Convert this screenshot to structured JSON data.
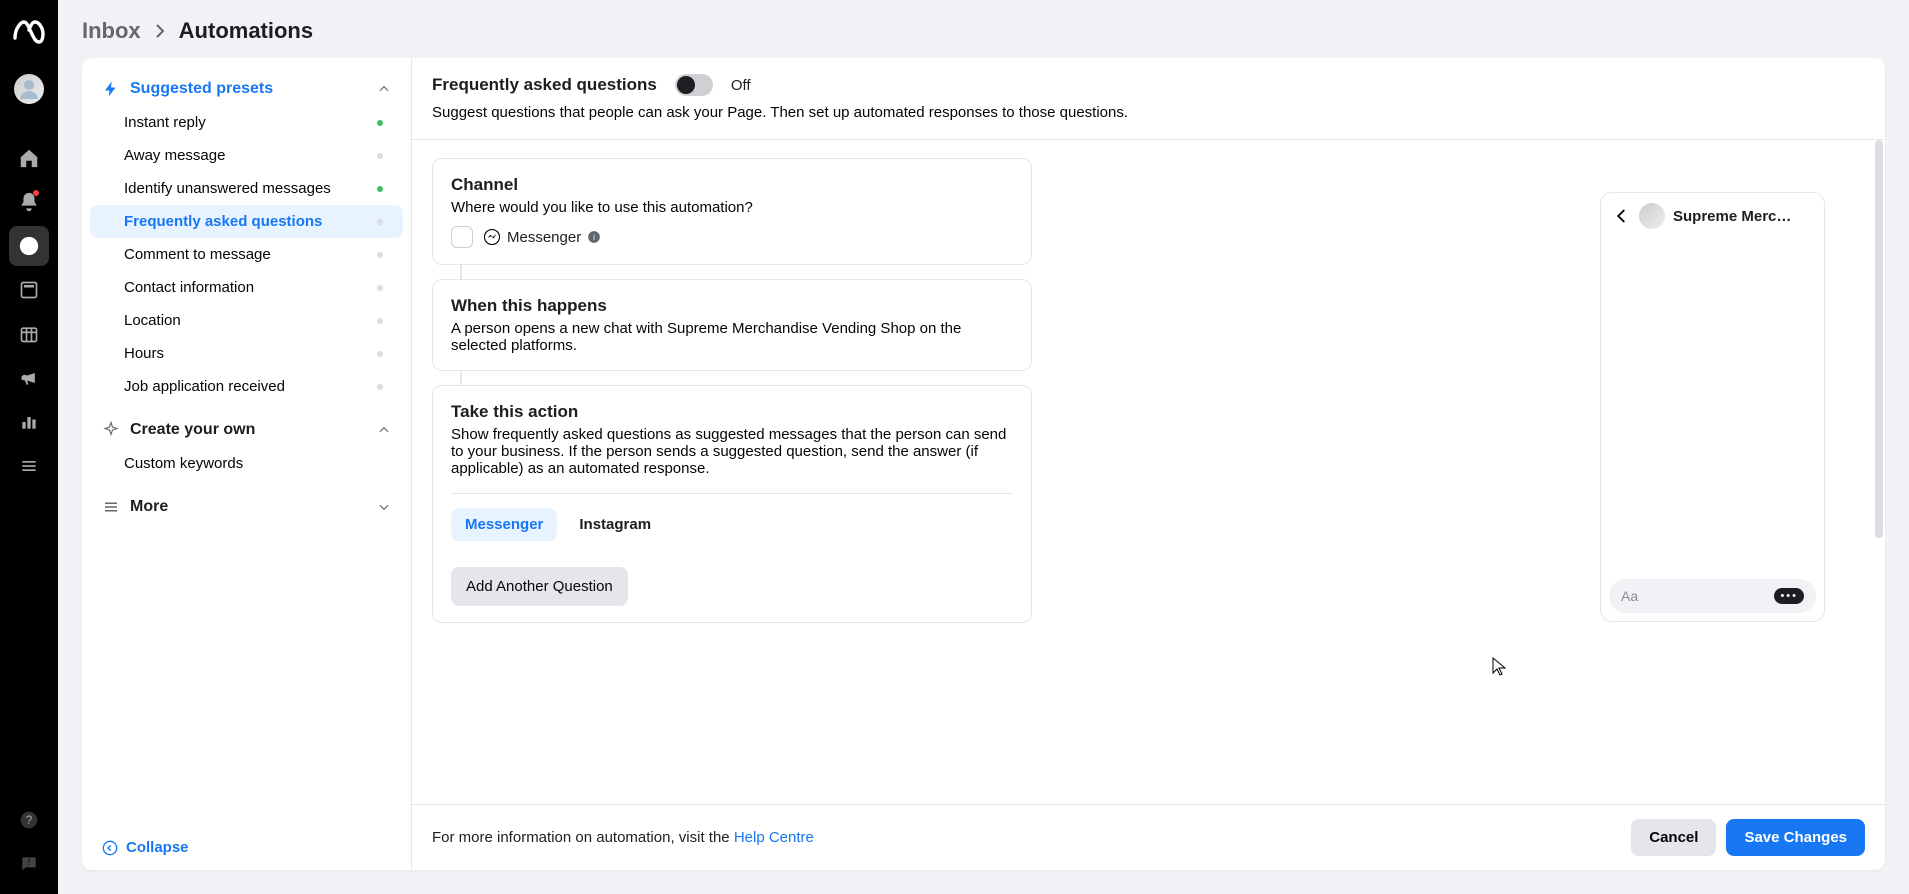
{
  "breadcrumb": {
    "inbox": "Inbox",
    "automations": "Automations"
  },
  "sidebar": {
    "suggested_label": "Suggested presets",
    "items": [
      {
        "label": "Instant reply",
        "status": "green"
      },
      {
        "label": "Away message",
        "status": "off"
      },
      {
        "label": "Identify unanswered messages",
        "status": "green"
      },
      {
        "label": "Frequently asked questions",
        "status": "off",
        "active": true
      },
      {
        "label": "Comment to message",
        "status": "off"
      },
      {
        "label": "Contact information",
        "status": "off"
      },
      {
        "label": "Location",
        "status": "off"
      },
      {
        "label": "Hours",
        "status": "off"
      },
      {
        "label": "Job application received",
        "status": "off"
      }
    ],
    "create_label": "Create your own",
    "custom_keywords": "Custom keywords",
    "more_label": "More",
    "collapse_label": "Collapse"
  },
  "header": {
    "title": "Frequently asked questions",
    "toggle_state": "Off",
    "description": "Suggest questions that people can ask your Page. Then set up automated responses to those questions."
  },
  "blocks": {
    "channel": {
      "title": "Channel",
      "desc": "Where would you like to use this automation?",
      "option": "Messenger"
    },
    "when": {
      "title": "When this happens",
      "desc": "A person opens a new chat with Supreme Merchandise Vending Shop on the selected platforms."
    },
    "action": {
      "title": "Take this action",
      "desc": "Show frequently asked questions as suggested messages that the person can send to your business. If the person sends a suggested question, send the answer (if applicable) as an automated response.",
      "tabs": {
        "messenger": "Messenger",
        "instagram": "Instagram"
      },
      "add_button": "Add Another Question"
    }
  },
  "preview": {
    "name": "Supreme Merc…",
    "placeholder": "Aa"
  },
  "footer": {
    "info_prefix": "For more information on automation, visit the ",
    "help_link": "Help Centre",
    "cancel": "Cancel",
    "save": "Save Changes"
  }
}
